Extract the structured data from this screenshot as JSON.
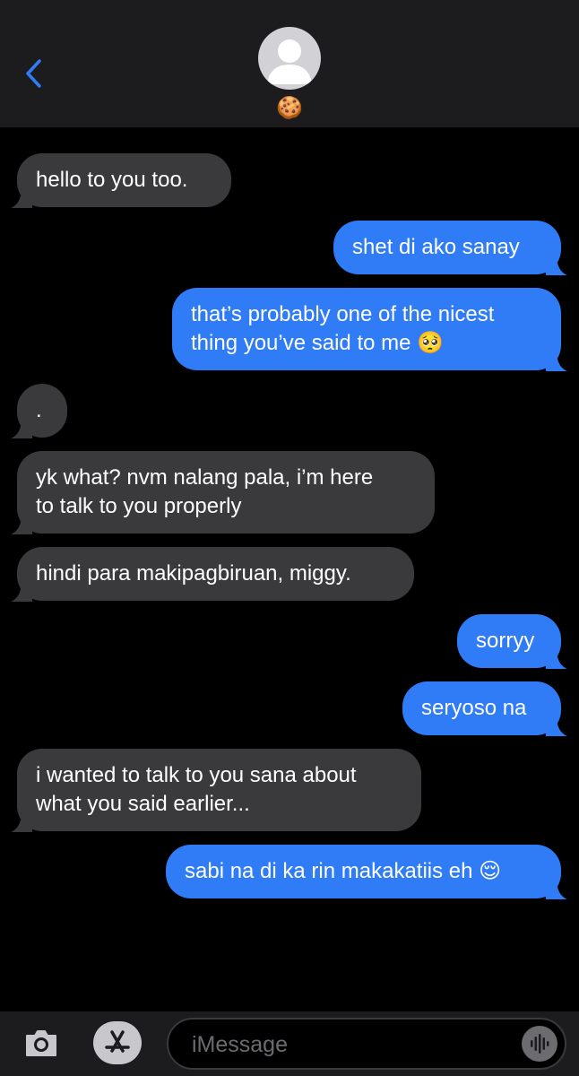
{
  "header": {
    "back_icon": "chevron-left-icon",
    "avatar_icon": "person-icon",
    "contact_name": "🍪"
  },
  "colors": {
    "background": "#000000",
    "header_bg": "#1c1c1e",
    "incoming_bubble": "#3a3a3c",
    "outgoing_bubble": "#2f7cf6",
    "accent": "#2f7cf6"
  },
  "messages": [
    {
      "direction": "incoming",
      "lines": [
        "hello to you too."
      ]
    },
    {
      "direction": "outgoing",
      "lines": [
        "shet di ako sanay"
      ]
    },
    {
      "direction": "outgoing",
      "lines": [
        "that’s probably one of the nicest",
        "thing you’ve said to me 🥺"
      ]
    },
    {
      "direction": "incoming",
      "lines": [
        "."
      ]
    },
    {
      "direction": "incoming",
      "lines": [
        "yk what? nvm nalang pala, i’m here",
        "to talk to you properly"
      ]
    },
    {
      "direction": "incoming",
      "lines": [
        "hindi para makipagbiruan, miggy."
      ]
    },
    {
      "direction": "outgoing",
      "lines": [
        "sorryy"
      ]
    },
    {
      "direction": "outgoing",
      "lines": [
        "seryoso na"
      ]
    },
    {
      "direction": "incoming",
      "lines": [
        "i wanted to talk to you sana about",
        "what you said earlier..."
      ]
    },
    {
      "direction": "outgoing",
      "lines": [
        "sabi na di ka rin makakatiis eh 😌"
      ]
    }
  ],
  "composer": {
    "camera_icon": "camera-icon",
    "appstore_icon": "app-store-icon",
    "placeholder": "iMessage",
    "value": "",
    "audio_icon": "audio-waveform-icon"
  }
}
